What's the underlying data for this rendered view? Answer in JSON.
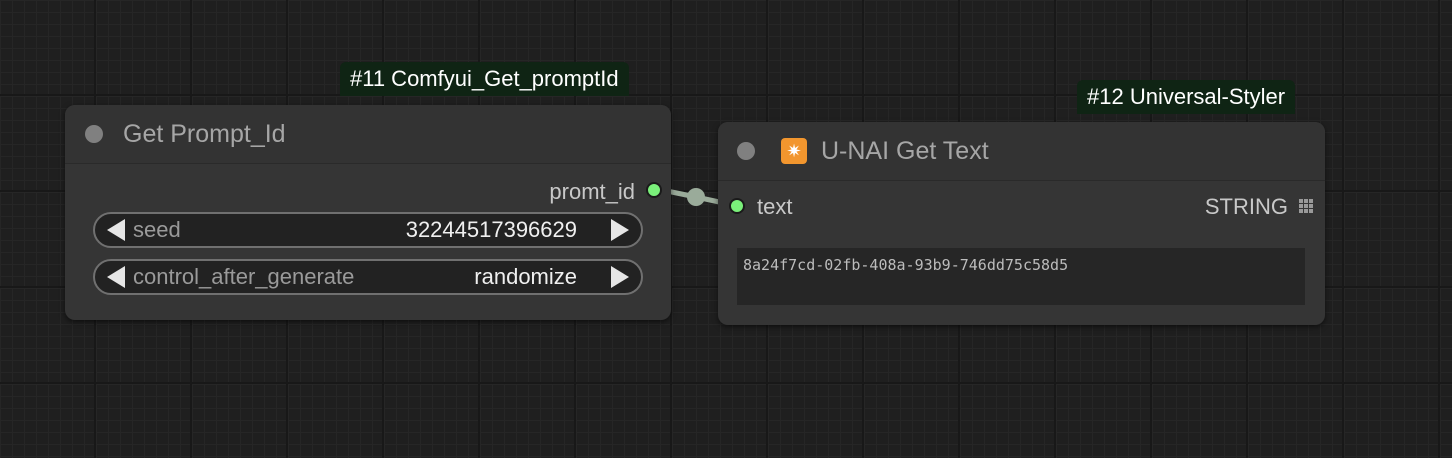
{
  "nodes": {
    "get_prompt_id": {
      "badge": "#11 Comfyui_Get_promptId",
      "title": "Get Prompt_Id",
      "output_label": "promt_id",
      "widgets": [
        {
          "label": "seed",
          "value": "32244517396629"
        },
        {
          "label": "control_after_generate",
          "value": "randomize"
        }
      ]
    },
    "get_text": {
      "badge": "#12 Universal-Styler",
      "title": "U-NAI Get Text",
      "icon": "sparkle-icon",
      "icon_glyph": "✷",
      "input_label": "text",
      "output_label": "STRING",
      "text_value": "8a24f7cd-02fb-408a-93b9-746dd75c58d5"
    }
  },
  "colors": {
    "slot_string": "#7af07a",
    "link": "#9aab9a",
    "badge_bg": "#0f2414",
    "node_bg": "#353535",
    "icon_bg": "#f2962e"
  }
}
